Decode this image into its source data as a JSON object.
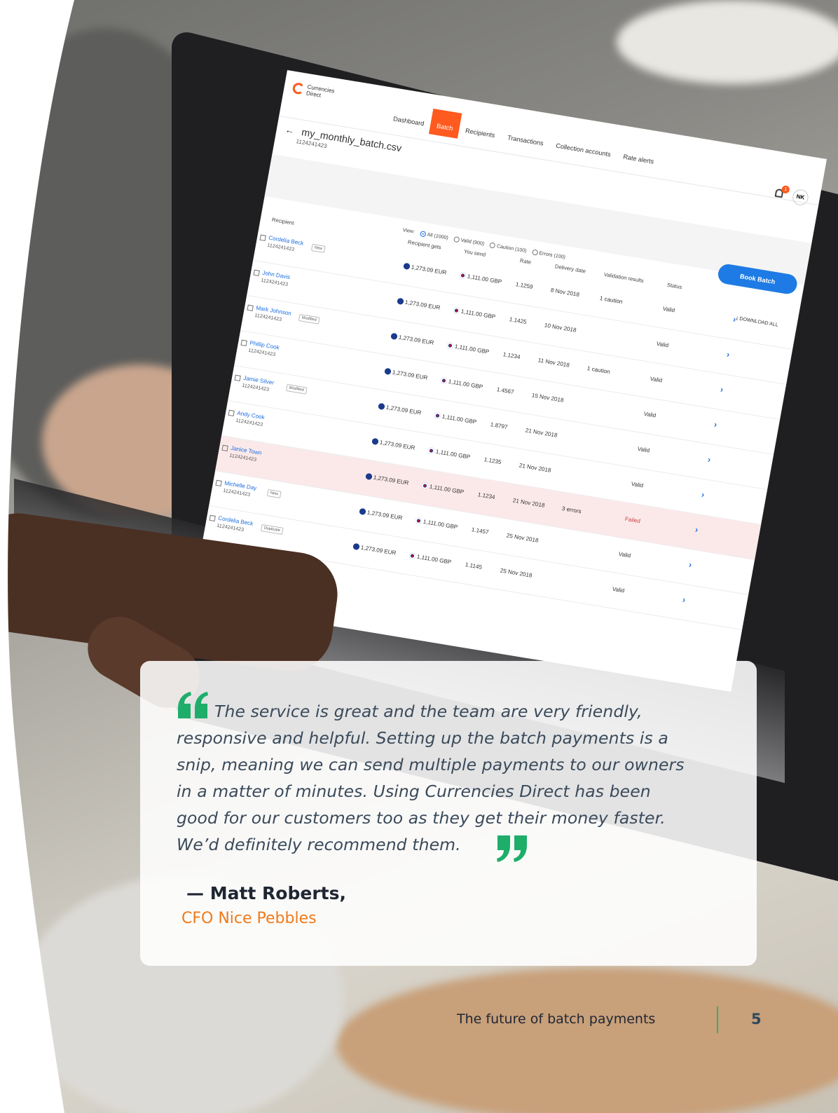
{
  "app": {
    "logo_text": "Currencies Direct",
    "nav": [
      "Dashboard",
      "Batch",
      "Recipients",
      "Transactions",
      "Collection accounts",
      "Rate alerts"
    ],
    "active_nav": "Batch",
    "notification_count": "1",
    "user_initials": "NK",
    "file_name": "my_monthly_batch.csv",
    "file_id": "1124241423",
    "view_label": "View:",
    "view_options": [
      "All (1000)",
      "Valid (900)",
      "Caution (100)",
      "Errors (100)"
    ],
    "book_button": "Book Batch",
    "download_all": "DOWNLOAD ALL",
    "columns": [
      "Recipient",
      "Recipient gets",
      "You send",
      "Rate",
      "Delivery date",
      "Validation results",
      "Status"
    ],
    "rows": [
      {
        "name": "Cordelia Beck",
        "id": "1124241423",
        "tag": "New",
        "gets": "1,273.09 EUR",
        "send": "1,111.00 GBP",
        "rate": "1.1259",
        "date": "8 Nov 2018",
        "validation": "1 caution",
        "status": "Valid"
      },
      {
        "name": "John Davis",
        "id": "1124241423",
        "tag": "",
        "gets": "1,273.09 EUR",
        "send": "1,111.00 GBP",
        "rate": "1.1425",
        "date": "10 Nov 2018",
        "validation": "",
        "status": "Valid"
      },
      {
        "name": "Mark Johnson",
        "id": "1124241423",
        "tag": "Modified",
        "gets": "1,273.09 EUR",
        "send": "1,111.00 GBP",
        "rate": "1.1234",
        "date": "11 Nov 2018",
        "validation": "1 caution",
        "status": "Valid"
      },
      {
        "name": "Phillip Cook",
        "id": "1124241423",
        "tag": "",
        "gets": "1,273.09 EUR",
        "send": "1,111.00 GBP",
        "rate": "1.4567",
        "date": "15 Nov 2018",
        "validation": "",
        "status": "Valid"
      },
      {
        "name": "Jamie Silver",
        "id": "1124241423",
        "tag": "Modified",
        "gets": "1,273.09 EUR",
        "send": "1,111.00 GBP",
        "rate": "1.8797",
        "date": "21 Nov 2018",
        "validation": "",
        "status": "Valid"
      },
      {
        "name": "Andy Cook",
        "id": "1124241423",
        "tag": "",
        "gets": "1,273.09 EUR",
        "send": "1,111.00 GBP",
        "rate": "1.1235",
        "date": "21 Nov 2018",
        "validation": "",
        "status": "Valid"
      },
      {
        "name": "Janice Town",
        "id": "1124241423",
        "tag": "",
        "gets": "1,273.09 EUR",
        "send": "1,111.00 GBP",
        "rate": "1.1234",
        "date": "21 Nov 2018",
        "validation": "3 errors",
        "status": "Failed"
      },
      {
        "name": "Michelle Day",
        "id": "1124241423",
        "tag": "New",
        "gets": "1,273.09 EUR",
        "send": "1,111.00 GBP",
        "rate": "1.1457",
        "date": "25 Nov 2018",
        "validation": "",
        "status": "Valid"
      },
      {
        "name": "Cordelia Beck",
        "id": "1124241423",
        "tag": "Duplicate",
        "gets": "1,273.09 EUR",
        "send": "1,111.00 GBP",
        "rate": "1.1145",
        "date": "25 Nov 2018",
        "validation": "",
        "status": "Valid"
      }
    ]
  },
  "quote": {
    "lines": [
      "The service is great and the team are very friendly,",
      "responsive and helpful. Setting up the batch payments is a",
      "snip, meaning we can send multiple payments to our owners",
      "in a matter of minutes. Using Currencies Direct has been",
      "good for our customers too as they get their money faster.",
      "We’d definitely recommend them."
    ],
    "author": "— Matt Roberts,",
    "role": "CFO Nice Pebbles"
  },
  "footer": {
    "title": "The future of batch payments",
    "page_number": "5"
  },
  "colors": {
    "quote_mark": "#1fae6a",
    "role": "#ef7a1a",
    "brand_orange": "#ff5a1f",
    "button_blue": "#1e7be5",
    "divider": "#2fb36f"
  }
}
